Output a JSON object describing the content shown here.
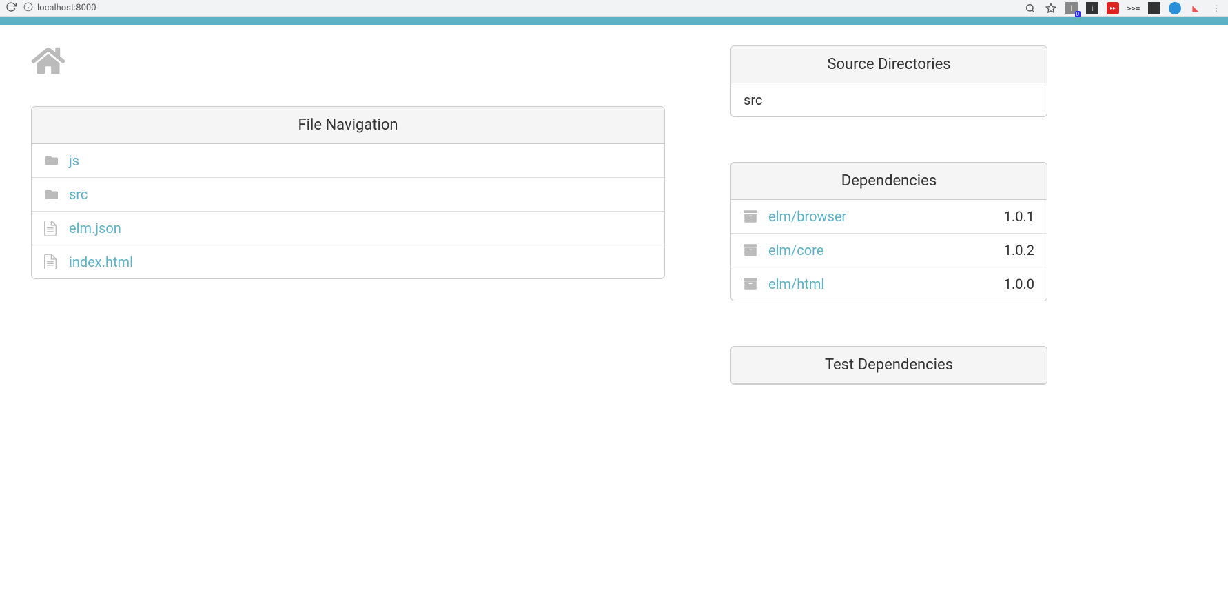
{
  "browser": {
    "url": "localhost:8000"
  },
  "panels": {
    "file_nav_title": "File Navigation",
    "source_dirs_title": "Source Directories",
    "dependencies_title": "Dependencies",
    "test_deps_title": "Test Dependencies"
  },
  "files": [
    {
      "type": "folder",
      "name": "js"
    },
    {
      "type": "folder",
      "name": "src"
    },
    {
      "type": "file",
      "name": "elm.json"
    },
    {
      "type": "file",
      "name": "index.html"
    }
  ],
  "source_dirs": [
    "src"
  ],
  "dependencies": [
    {
      "name": "elm/browser",
      "version": "1.0.1"
    },
    {
      "name": "elm/core",
      "version": "1.0.2"
    },
    {
      "name": "elm/html",
      "version": "1.0.0"
    }
  ]
}
